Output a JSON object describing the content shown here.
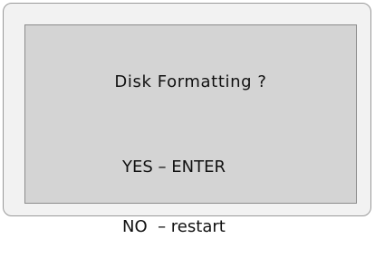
{
  "dialog": {
    "title": "Disk Formatting ?",
    "options": [
      {
        "label": "YES – ENTER"
      },
      {
        "label": "NO  – restart"
      }
    ]
  }
}
